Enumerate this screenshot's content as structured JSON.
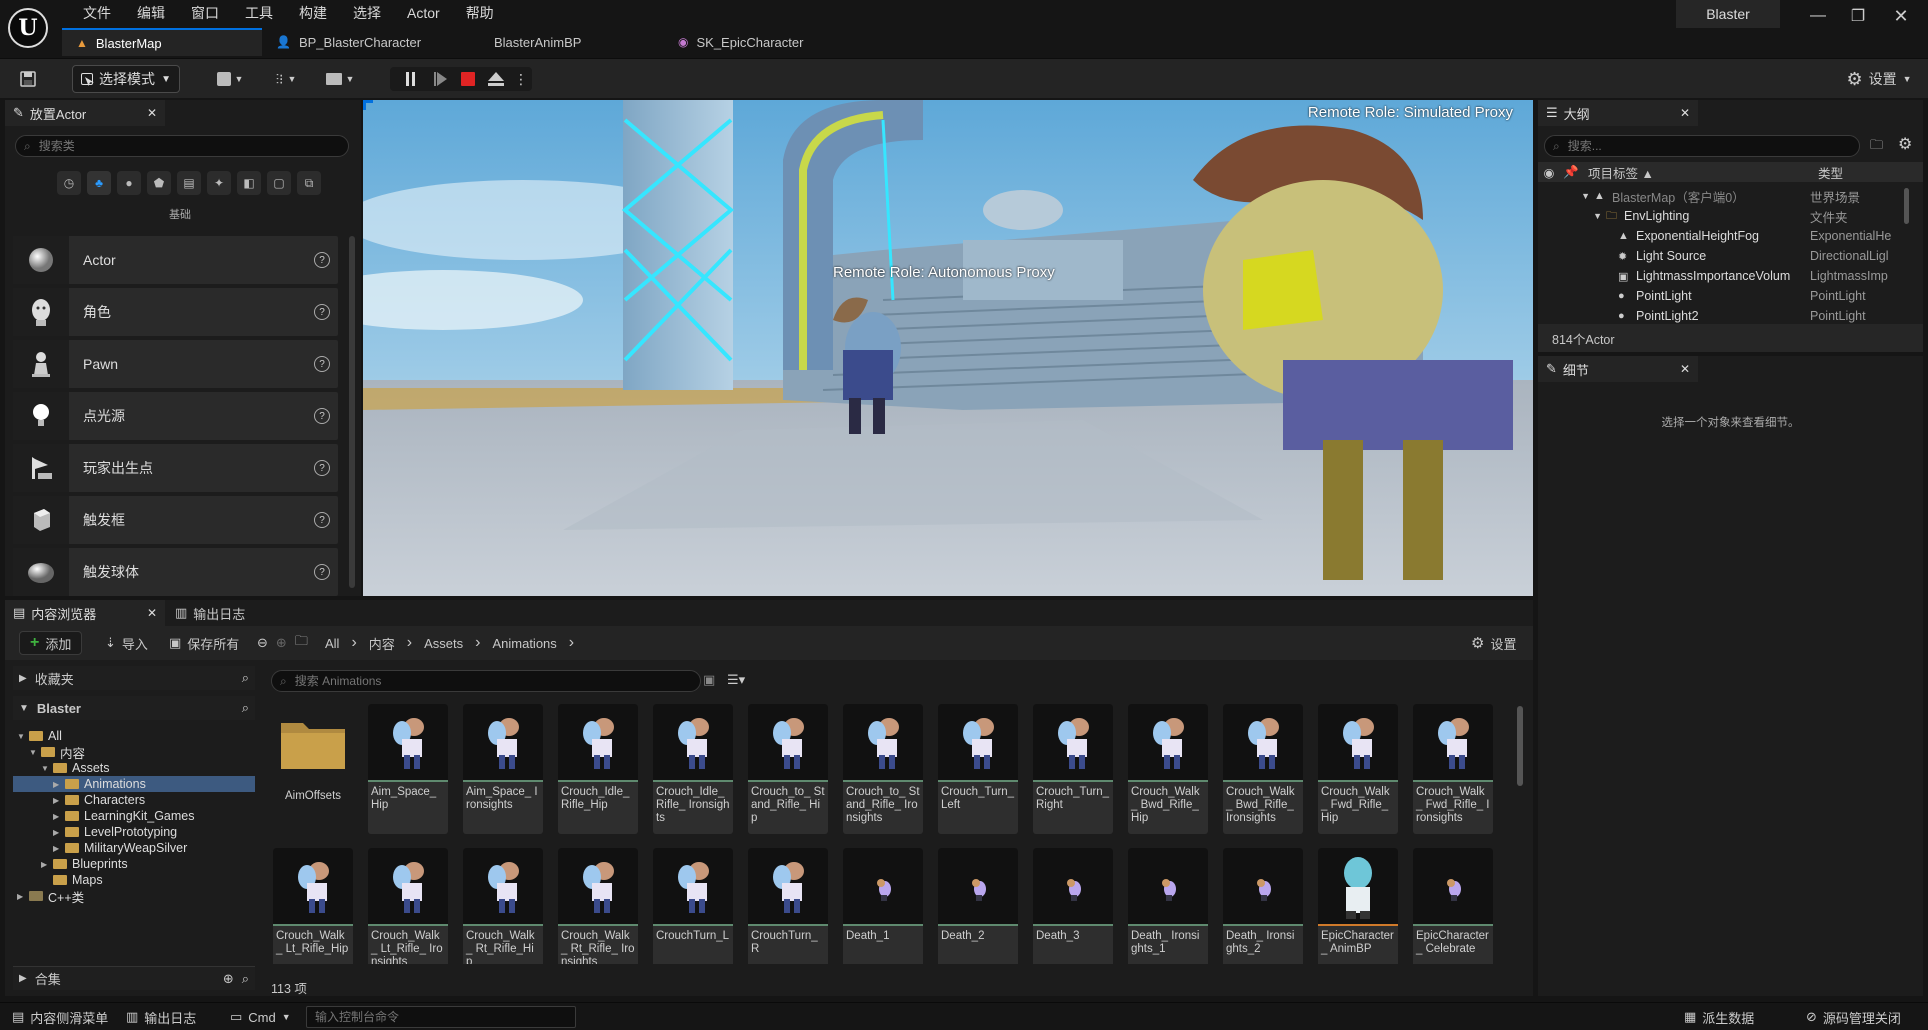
{
  "menu": [
    "文件",
    "编辑",
    "窗口",
    "工具",
    "构建",
    "选择",
    "Actor",
    "帮助"
  ],
  "project_name": "Blaster",
  "doc_tabs": [
    {
      "label": "BlasterMap",
      "icon": "level-icon"
    },
    {
      "label": "BP_BlasterCharacter",
      "icon": "blueprint-icon"
    },
    {
      "label": "BlasterAnimBP",
      "icon": "anim-blueprint-icon"
    },
    {
      "label": "SK_EpicCharacter",
      "icon": "skeletal-mesh-icon"
    }
  ],
  "toolbar": {
    "mode_label": "选择模式",
    "settings_label": "设置"
  },
  "place_actors": {
    "tab_title": "放置Actor",
    "search_placeholder": "搜索类",
    "category_label": "基础",
    "items": [
      {
        "label": "Actor",
        "icon": "sphere-icon"
      },
      {
        "label": "角色",
        "icon": "character-icon"
      },
      {
        "label": "Pawn",
        "icon": "pawn-icon"
      },
      {
        "label": "点光源",
        "icon": "point-light-icon"
      },
      {
        "label": "玩家出生点",
        "icon": "player-start-icon"
      },
      {
        "label": "触发框",
        "icon": "trigger-box-icon"
      },
      {
        "label": "触发球体",
        "icon": "trigger-sphere-icon"
      }
    ]
  },
  "viewport": {
    "overlay_top_right": "Remote Role: Simulated Proxy",
    "overlay_center": "Remote Role: Autonomous Proxy"
  },
  "outliner": {
    "tab_title": "大纲",
    "search_placeholder": "搜索...",
    "col_label": "项目标签 ▲",
    "col_type": "类型",
    "rows": [
      {
        "label": "BlasterMap（客户端0）",
        "type": "世界场景",
        "indent": 0,
        "icon": "world-icon",
        "dim": true
      },
      {
        "label": "EnvLighting",
        "type": "文件夹",
        "indent": 1,
        "icon": "folder-icon"
      },
      {
        "label": "ExponentialHeightFog",
        "type": "ExponentialHe",
        "indent": 2,
        "icon": "fog-icon"
      },
      {
        "label": "Light Source",
        "type": "DirectionalLigl",
        "indent": 2,
        "icon": "directional-light-icon"
      },
      {
        "label": "LightmassImportanceVolum",
        "type": "LightmassImp",
        "indent": 2,
        "icon": "volume-icon"
      },
      {
        "label": "PointLight",
        "type": "PointLight",
        "indent": 2,
        "icon": "point-light-icon"
      },
      {
        "label": "PointLight2",
        "type": "PointLight",
        "indent": 2,
        "icon": "point-light-icon"
      }
    ],
    "count": "814个Actor"
  },
  "details": {
    "tab_title": "细节",
    "empty_message": "选择一个对象来查看细节。"
  },
  "content_browser": {
    "tab_title": "内容浏览器",
    "log_tab": "输出日志",
    "add_label": "添加",
    "import_label": "导入",
    "save_all_label": "保存所有",
    "breadcrumb": [
      "All",
      "内容",
      "Assets",
      "Animations"
    ],
    "settings_label": "设置",
    "favorites_label": "收藏夹",
    "project_label": "Blaster",
    "collections_label": "合集",
    "search_placeholder": "搜索 Animations",
    "tree": [
      {
        "label": "All",
        "indent": 0,
        "open": true
      },
      {
        "label": "内容",
        "indent": 1,
        "open": true
      },
      {
        "label": "Assets",
        "indent": 2,
        "open": true
      },
      {
        "label": "Animations",
        "indent": 3,
        "selected": true
      },
      {
        "label": "Characters",
        "indent": 3
      },
      {
        "label": "LearningKit_Games",
        "indent": 3
      },
      {
        "label": "LevelPrototyping",
        "indent": 3
      },
      {
        "label": "MilitaryWeapSilver",
        "indent": 3
      },
      {
        "label": "Blueprints",
        "indent": 2
      },
      {
        "label": "Maps",
        "indent": 2,
        "nochev": true
      },
      {
        "label": "C++类",
        "indent": 0,
        "cpp": true
      }
    ],
    "assets": [
      {
        "name": "AimOffsets",
        "folder": true
      },
      {
        "name": "Aim_Space_ Hip"
      },
      {
        "name": "Aim_Space_ Ironsights"
      },
      {
        "name": "Crouch_Idle_ Rifle_Hip"
      },
      {
        "name": "Crouch_Idle_ Rifle_ Ironsights"
      },
      {
        "name": "Crouch_to_ Stand_Rifle_ Hip"
      },
      {
        "name": "Crouch_to_ Stand_Rifle_ Ironsights"
      },
      {
        "name": "Crouch_Turn_ Left"
      },
      {
        "name": "Crouch_Turn_ Right"
      },
      {
        "name": "Crouch_Walk_ Bwd_Rifle_Hip"
      },
      {
        "name": "Crouch_Walk_ Bwd_Rifle_ Ironsights"
      },
      {
        "name": "Crouch_Walk_ Fwd_Rifle_Hip"
      },
      {
        "name": "Crouch_Walk_ Fwd_Rifle_ Ironsights"
      },
      {
        "name": "Crouch_Walk_ Lt_Rifle_Hip"
      },
      {
        "name": "Crouch_Walk_ Lt_Rifle_ Ironsights"
      },
      {
        "name": "Crouch_Walk_ Rt_Rifle_Hip"
      },
      {
        "name": "Crouch_Walk_ Rt_Rifle_ Ironsights"
      },
      {
        "name": "CrouchTurn_L"
      },
      {
        "name": "CrouchTurn_R"
      },
      {
        "name": "Death_1",
        "small": true
      },
      {
        "name": "Death_2",
        "small": true
      },
      {
        "name": "Death_3",
        "small": true
      },
      {
        "name": "Death_ Ironsights_1",
        "small": true
      },
      {
        "name": "Death_ Ironsights_2",
        "small": true
      },
      {
        "name": "EpicCharacter_ AnimBP",
        "animbp": true
      },
      {
        "name": "EpicCharacter_ Celebrate",
        "small": true
      }
    ],
    "item_count": "113 项"
  },
  "statusbar": {
    "drawer_label": "内容侧滑菜单",
    "log_label": "输出日志",
    "cmd_label": "Cmd",
    "console_placeholder": "输入控制台命令",
    "derived_data_label": "派生数据",
    "source_control_label": "源码管理关闭"
  },
  "colors": {
    "accent": "#0070e0",
    "stop": "#e02424",
    "add_green": "#3fb23f"
  }
}
